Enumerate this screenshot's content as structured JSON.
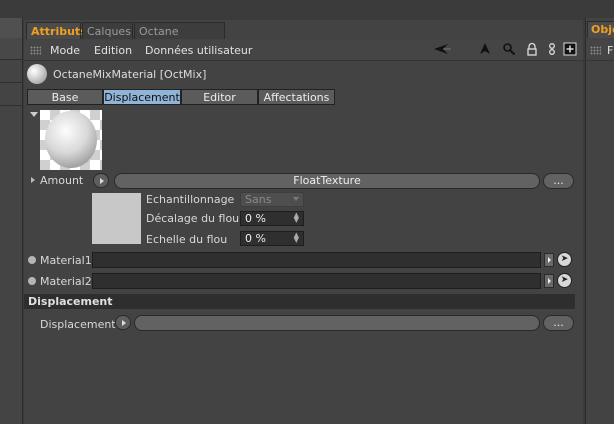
{
  "tabs": [
    {
      "label": "Attributs",
      "active": true
    },
    {
      "label": "Calques",
      "active": false
    },
    {
      "label": "Octane Settings",
      "active": false
    }
  ],
  "right_tab": {
    "label": "Obje"
  },
  "right_menu_letter": "F",
  "menu": [
    "Mode",
    "Edition",
    "Données utilisateur"
  ],
  "toolbar_icons": [
    "back-arrow-icon",
    "up-arrow-icon",
    "search-icon",
    "lock-icon",
    "link-icon",
    "new-window-icon"
  ],
  "material": {
    "title": "OctaneMixMaterial [OctMix]"
  },
  "subtabs": [
    {
      "label": "Base",
      "active": false
    },
    {
      "label": "Displacement",
      "active": true
    },
    {
      "label": "Editor",
      "active": false
    },
    {
      "label": "Affectations",
      "active": false
    }
  ],
  "amount": {
    "label": "Amount",
    "texture": "FloatTexture",
    "more": "..."
  },
  "sampling": {
    "label": "Echantillonnage",
    "value": "Sans"
  },
  "blur_offset": {
    "label": "Décalage du flou",
    "value": "0 %"
  },
  "blur_scale": {
    "label": "Echelle du flou",
    "value": "0 %"
  },
  "material1": {
    "label": "Material1"
  },
  "material2": {
    "label": "Material2"
  },
  "section": {
    "title": "Displacement"
  },
  "displacement": {
    "label": "Displacement",
    "more": "..."
  }
}
